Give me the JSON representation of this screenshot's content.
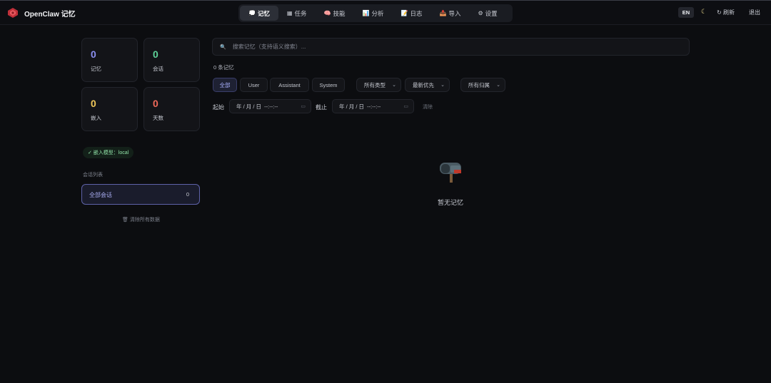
{
  "header": {
    "brand_title": "OpenClaw 记忆",
    "nav": [
      {
        "label": "记忆",
        "icon": "💭",
        "active": true
      },
      {
        "label": "任务",
        "icon": "▦",
        "active": false
      },
      {
        "label": "技能",
        "icon": "🧠",
        "active": false
      },
      {
        "label": "分析",
        "icon": "📊",
        "active": false
      },
      {
        "label": "日志",
        "icon": "📝",
        "active": false
      },
      {
        "label": "导入",
        "icon": "📥",
        "active": false
      },
      {
        "label": "设置",
        "icon": "⚙",
        "active": false
      }
    ],
    "lang": "EN",
    "theme_icon": "☾",
    "refresh": "↻ 刷新",
    "logout": "退出"
  },
  "stats": [
    {
      "value": "0",
      "label": "记忆",
      "color": "#8b8ff0"
    },
    {
      "value": "0",
      "label": "会话",
      "color": "#5fd49a"
    },
    {
      "value": "0",
      "label": "嵌入",
      "color": "#f0c85a"
    },
    {
      "value": "0",
      "label": "天数",
      "color": "#f06a5a"
    }
  ],
  "sidebar": {
    "embed_model": "✓ 嵌入模型：local",
    "session_heading": "会话列表",
    "sessions": [
      {
        "name": "全部会话",
        "count": "0"
      }
    ],
    "clear_all": "🗑 清除所有数据"
  },
  "search": {
    "placeholder": "搜索记忆（支持语义搜索）..."
  },
  "result_count": "0 条记忆",
  "filters": {
    "roles": [
      "全部",
      "User",
      "Assistant",
      "System"
    ],
    "type_select": "所有类型",
    "sort_select": "最新优先",
    "owner_select": "所有归属"
  },
  "date_range": {
    "from_label": "起始",
    "to_label": "截止",
    "from_value": "年 / 月 / 日  --:--:--",
    "to_value": "年 / 月 / 日  --:--:--",
    "clear": "清除"
  },
  "empty_state": {
    "text": "暂无记忆",
    "icon": "mailbox-icon"
  },
  "colors": {
    "accent": "#5e62a8",
    "background": "#0c0d10"
  }
}
